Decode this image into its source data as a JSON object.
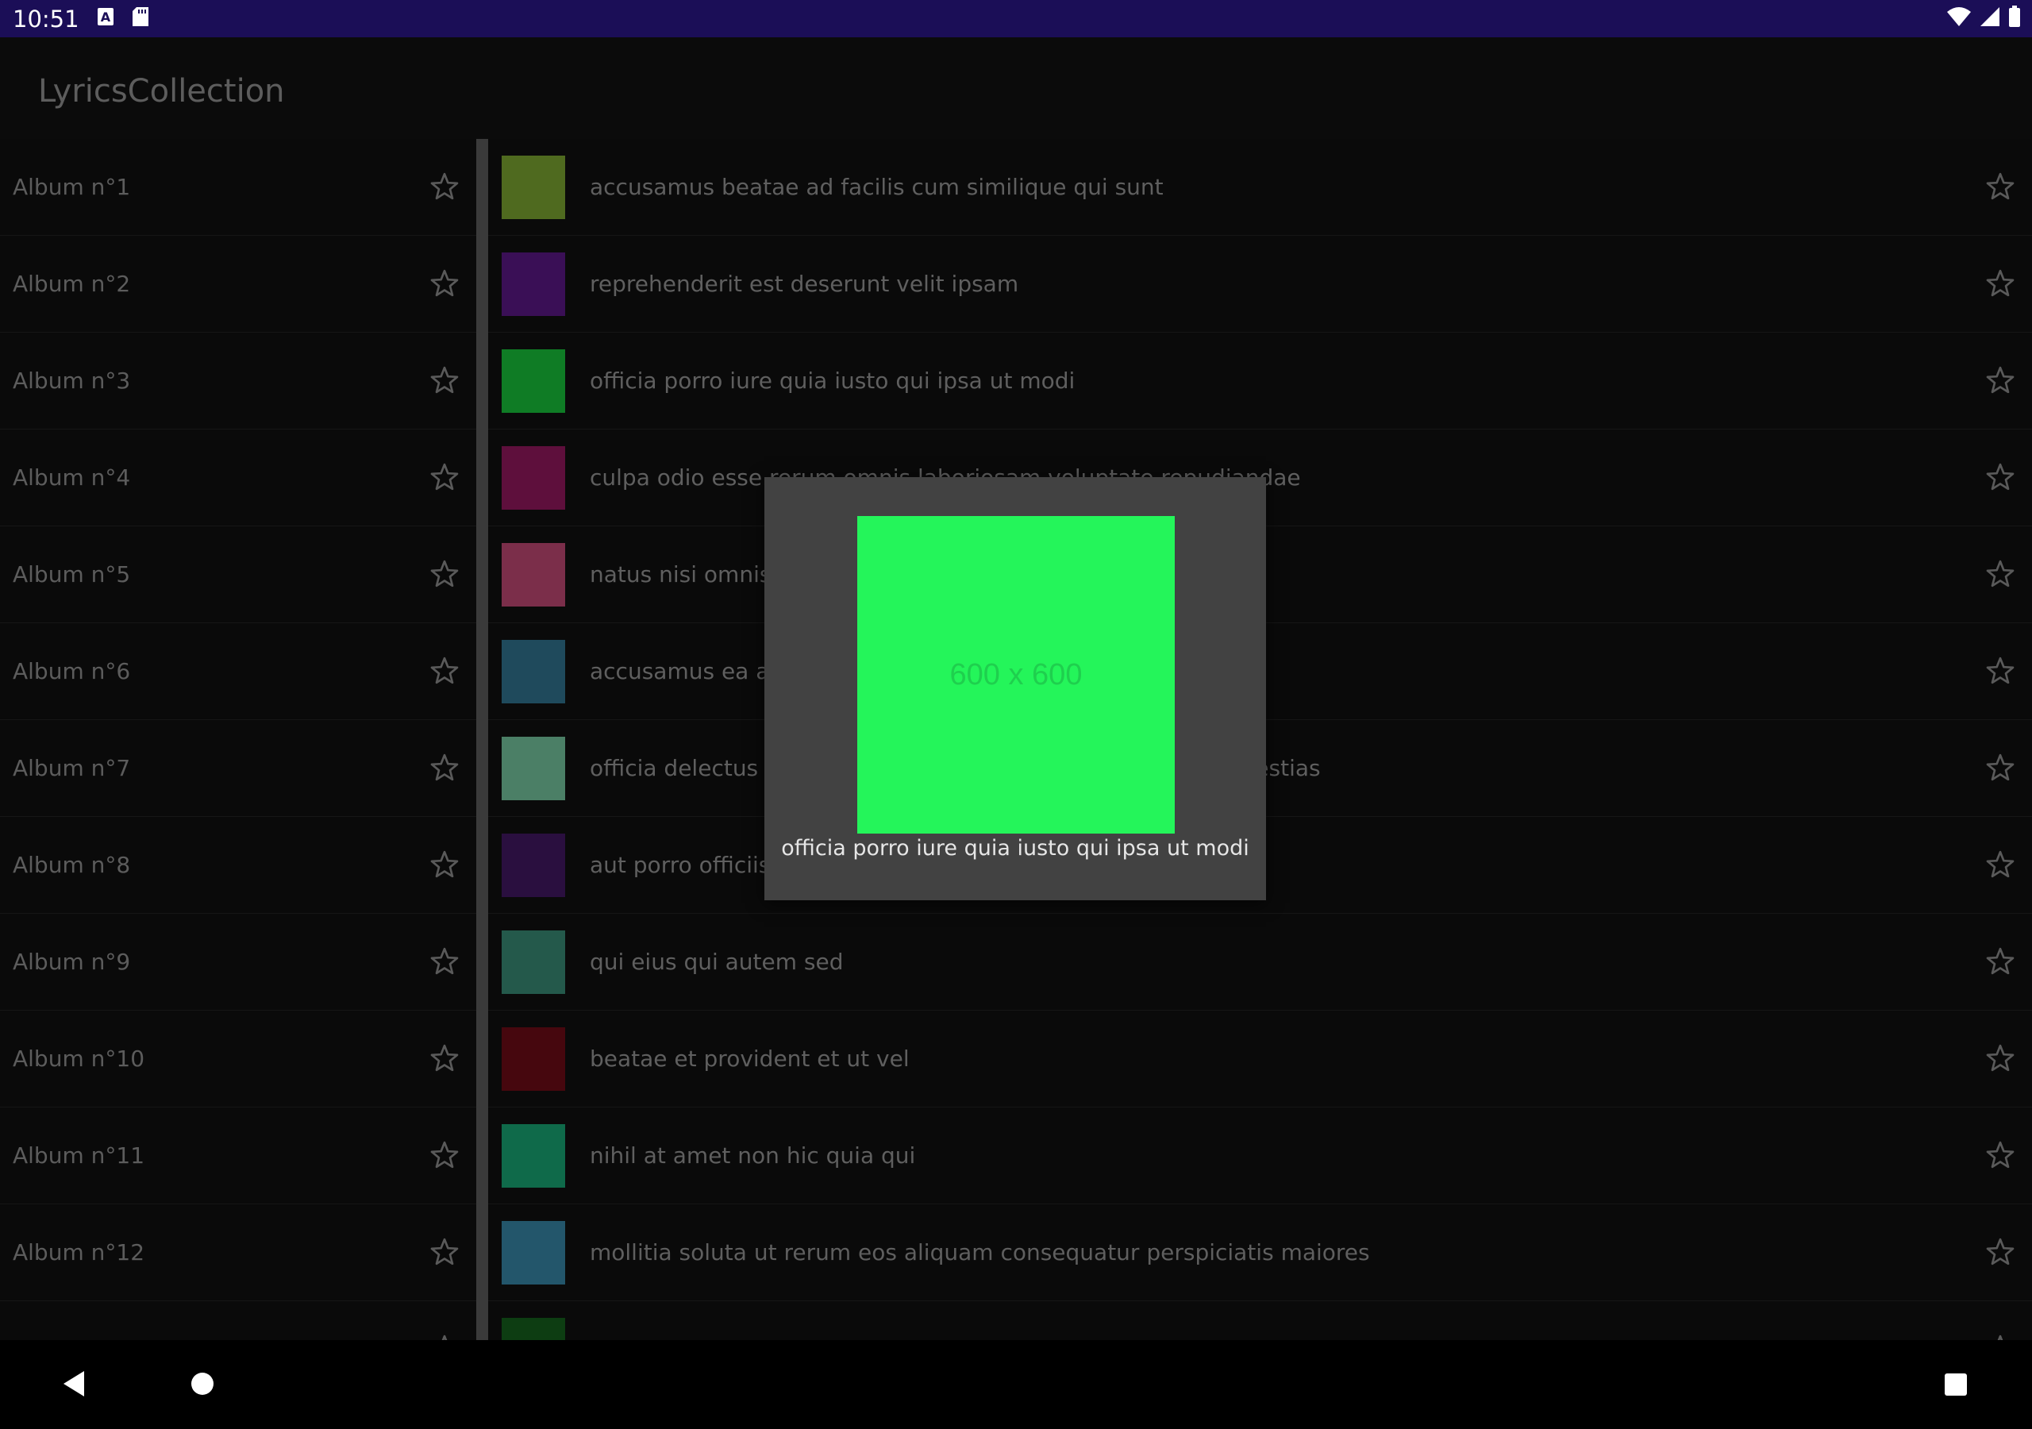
{
  "status_bar": {
    "time": "10:51",
    "left_icons": [
      "a-notification-icon",
      "sd-card-icon"
    ],
    "right_icons": [
      "wifi-icon",
      "signal-icon",
      "battery-icon"
    ]
  },
  "app_bar": {
    "title": "LyricsCollection"
  },
  "albums": [
    {
      "label": "Album n°1"
    },
    {
      "label": "Album n°2"
    },
    {
      "label": "Album n°3"
    },
    {
      "label": "Album n°4"
    },
    {
      "label": "Album n°5"
    },
    {
      "label": "Album n°6"
    },
    {
      "label": "Album n°7"
    },
    {
      "label": "Album n°8"
    },
    {
      "label": "Album n°9"
    },
    {
      "label": "Album n°10"
    },
    {
      "label": "Album n°11"
    },
    {
      "label": "Album n°12"
    }
  ],
  "lyrics": [
    {
      "title": "accusamus beatae ad facilis cum similique qui sunt",
      "color": "#4f6a1f"
    },
    {
      "title": "reprehenderit est deserunt velit ipsam",
      "color": "#3a0f56"
    },
    {
      "title": "officia porro iure quia iusto qui ipsa ut modi",
      "color": "#0f7c25"
    },
    {
      "title": "culpa odio esse rerum omnis laboriosam voluptate repudiandae",
      "color": "#5e0f3c"
    },
    {
      "title": "natus nisi omnis corporis facere molestiae rerum in",
      "color": "#7b2e4a"
    },
    {
      "title": "accusamus ea aliquid et amet sequi nemo",
      "color": "#1f4a5c"
    },
    {
      "title": "officia delectus consequatur vero aut veniam explicabo molestias",
      "color": "#4b7f66"
    },
    {
      "title": "aut porro officiis laborum odit ea laudantium corporis",
      "color": "#2a0f3f"
    },
    {
      "title": "qui eius qui autem sed",
      "color": "#24594b"
    },
    {
      "title": "beatae et provident et ut vel",
      "color": "#46070e"
    },
    {
      "title": "nihil at amet non hic quia qui",
      "color": "#0f6a4a"
    },
    {
      "title": "mollitia soluta ut rerum eos aliquam consequatur perspiciatis maiores",
      "color": "#23566b"
    },
    {
      "title": "",
      "color": "#0d3d12"
    }
  ],
  "modal": {
    "image_text": "600 x 600",
    "image_color": "#24f55a",
    "caption": "officia porro iure quia iusto qui ipsa ut modi"
  },
  "nav_bar": {
    "icons": [
      "back-icon",
      "home-icon",
      "recents-icon"
    ]
  }
}
